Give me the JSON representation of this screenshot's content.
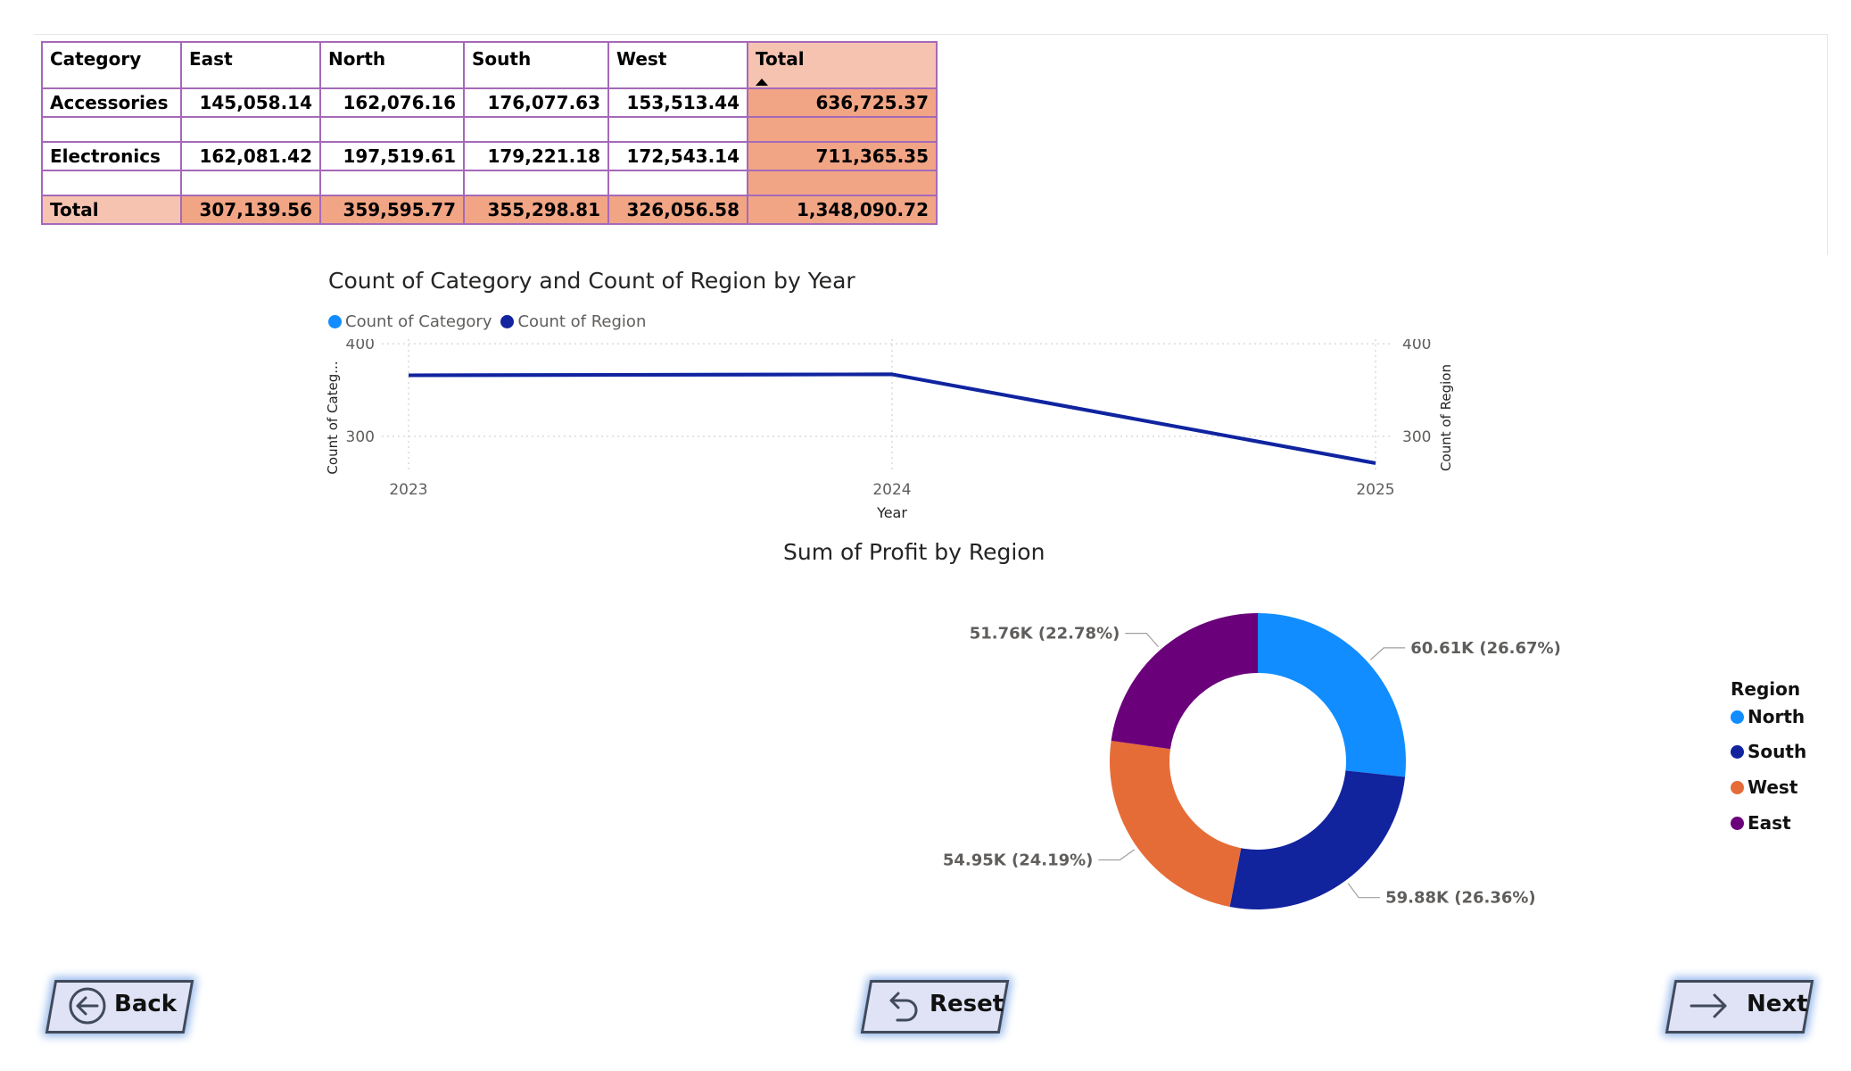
{
  "matrix": {
    "headers": [
      "Category",
      "East",
      "North",
      "South",
      "West",
      "Total"
    ],
    "rows": [
      {
        "label": "Accessories",
        "values": [
          "145,058.14",
          "162,076.16",
          "176,077.63",
          "153,513.44",
          "636,725.37"
        ]
      },
      {
        "label": "Electronics",
        "values": [
          "162,081.42",
          "197,519.61",
          "179,221.18",
          "172,543.14",
          "711,365.35"
        ]
      }
    ],
    "total": {
      "label": "Total",
      "values": [
        "307,139.56",
        "359,595.77",
        "355,298.81",
        "326,056.58",
        "1,348,090.72"
      ]
    },
    "sorted_column": "Total",
    "colors": {
      "border": "#a569b8",
      "total_light": "#f6c3b1",
      "total_mid": "#f1a585"
    }
  },
  "chart_data": [
    {
      "type": "line",
      "title": "Count of Category and Count of Region by Year",
      "xlabel": "Year",
      "ylabel": "Count of Categ...",
      "y2label": "Count of Region",
      "x": [
        "2023",
        "2024",
        "2025"
      ],
      "yticks": [
        "300",
        "400"
      ],
      "y2ticks": [
        "300",
        "400"
      ],
      "ylim": [
        270,
        405
      ],
      "series": [
        {
          "name": "Count of Category",
          "color": "#118dff",
          "values": [
            366,
            367,
            271
          ]
        },
        {
          "name": "Count of Region",
          "color": "#12239e",
          "values": [
            366,
            367,
            271
          ]
        }
      ],
      "grid": true,
      "legend": "top-left"
    },
    {
      "type": "pie",
      "donut": true,
      "title": "Sum of Profit by Region",
      "legend_title": "Region",
      "legend": "right",
      "slices": [
        {
          "name": "North",
          "value": 60.61,
          "label": "60.61K (26.67%)",
          "color": "#118dff"
        },
        {
          "name": "South",
          "value": 59.88,
          "label": "59.88K (26.36%)",
          "color": "#12239e"
        },
        {
          "name": "West",
          "value": 54.95,
          "label": "54.95K (24.19%)",
          "color": "#e66c37"
        },
        {
          "name": "East",
          "value": 51.76,
          "label": "51.76K (22.78%)",
          "color": "#6b007b"
        }
      ]
    }
  ],
  "buttons": {
    "back": {
      "label": "Back",
      "icon": "back-circle-arrow-icon"
    },
    "reset": {
      "label": "Reset",
      "icon": "undo-arrow-icon"
    },
    "next": {
      "label": "Next",
      "icon": "right-arrow-icon"
    }
  }
}
